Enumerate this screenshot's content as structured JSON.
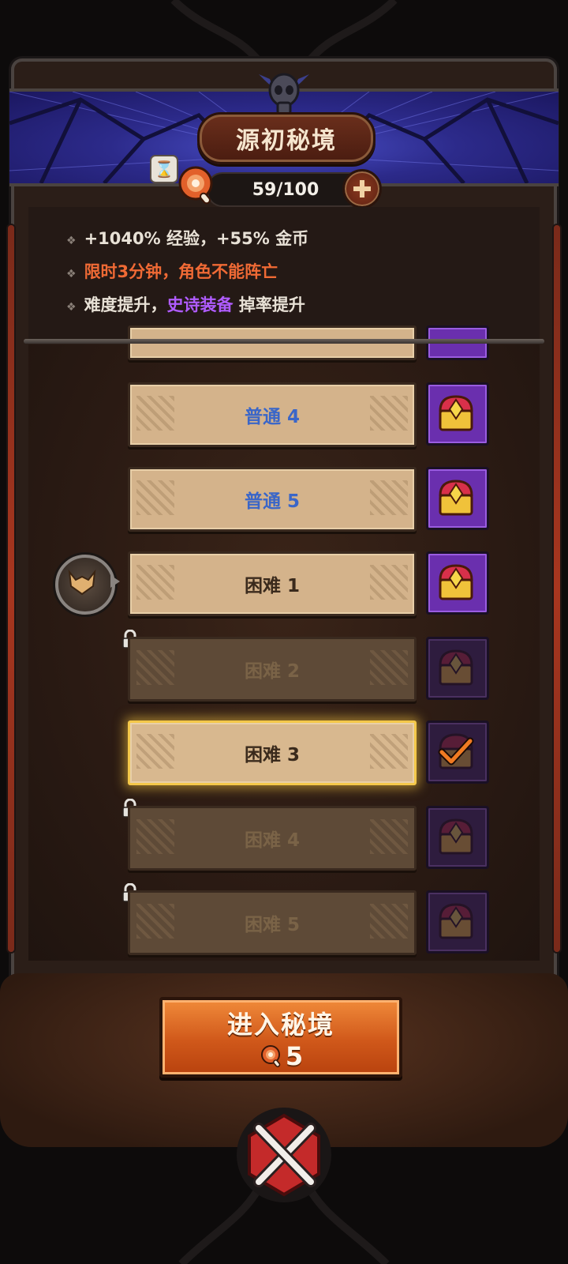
{
  "header": {
    "title": "源初秘境",
    "stamina": "59/100"
  },
  "info": {
    "line1": "+1040% 经验，+55% 金币",
    "line2": "限时3分钟，角色不能阵亡",
    "line3_prefix": "难度提升，",
    "line3_highlight": "史诗装备",
    "line3_suffix": " 掉率提升"
  },
  "levels": [
    {
      "label": "普通 4",
      "state": "normal"
    },
    {
      "label": "普通 5",
      "state": "normal"
    },
    {
      "label": "困难 1",
      "state": "unlocked"
    },
    {
      "label": "困难 2",
      "state": "locked"
    },
    {
      "label": "困难 3",
      "state": "selected"
    },
    {
      "label": "困难 4",
      "state": "locked"
    },
    {
      "label": "困难 5",
      "state": "locked"
    }
  ],
  "enter_button": {
    "label": "进入秘境",
    "cost": "5"
  },
  "colors": {
    "accent_orange": "#d0581a",
    "epic_purple": "#b05cff",
    "warning_red": "#f06a35",
    "normal_blue": "#3a66c8",
    "selected_gold": "#f4c84a"
  },
  "icons": [
    "hourglass-icon",
    "meat-icon",
    "plus-icon",
    "chest-icon",
    "lock-icon",
    "check-icon",
    "wolf-icon",
    "skull-icon",
    "close-icon"
  ]
}
